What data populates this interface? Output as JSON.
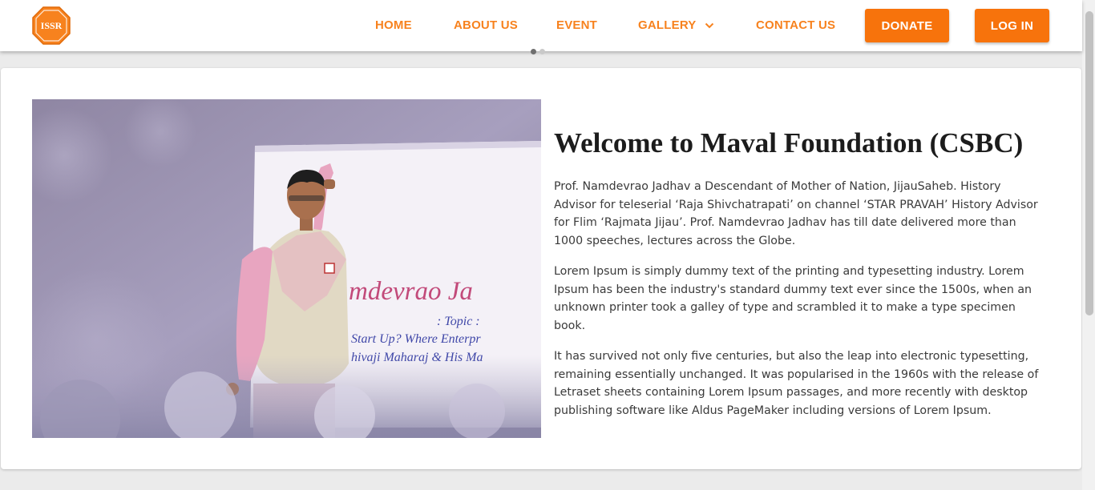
{
  "brand": {
    "logo_text": "ISSR"
  },
  "nav": {
    "home": "HOME",
    "about": "ABOUT US",
    "event": "EVENT",
    "gallery": "GALLERY",
    "contact": "CONTACT US"
  },
  "buttons": {
    "donate": "DONATE",
    "login": "LOG IN"
  },
  "carousel": {
    "slide_count": 2,
    "active_index": 0
  },
  "hero": {
    "banner_name": "mdevrao Ja",
    "banner_topic": ": Topic :",
    "banner_line1": "Start Up? Where Enterpr",
    "banner_line2": "hivaji Maharaj & His Ma"
  },
  "content": {
    "heading": "Welcome to Maval Foundation (CSBC)",
    "paragraphs": [
      "Prof. Namdevrao Jadhav a Descendant of Mother of Nation, JijauSaheb. History Advisor for teleserial ‘Raja Shivchatrapati’ on channel ‘STAR PRAVAH’ History Advisor for Flim ‘Rajmata Jijau’. Prof. Namdevrao Jadhav has till date delivered more than 1000 speeches, lectures across the Globe.",
      "Lorem Ipsum is simply dummy text of the printing and typesetting industry. Lorem Ipsum has been the industry's standard dummy text ever since the 1500s, when an unknown printer took a galley of type and scrambled it to make a type specimen book.",
      "It has survived not only five centuries, but also the leap into electronic typesetting, remaining essentially unchanged. It was popularised in the 1960s with the release of Letraset sheets containing Lorem Ipsum passages, and more recently with desktop publishing software like Aldus PageMaker including versions of Lorem Ipsum."
    ]
  },
  "colors": {
    "accent": "#f7821e",
    "button": "#f7730c",
    "page_bg": "#ebebeb",
    "heading": "#1c1c1c",
    "body_text": "#3a3a3a"
  },
  "icons": {
    "logo": "issr-logo-icon",
    "gallery_dropdown": "chevron-down-icon"
  }
}
